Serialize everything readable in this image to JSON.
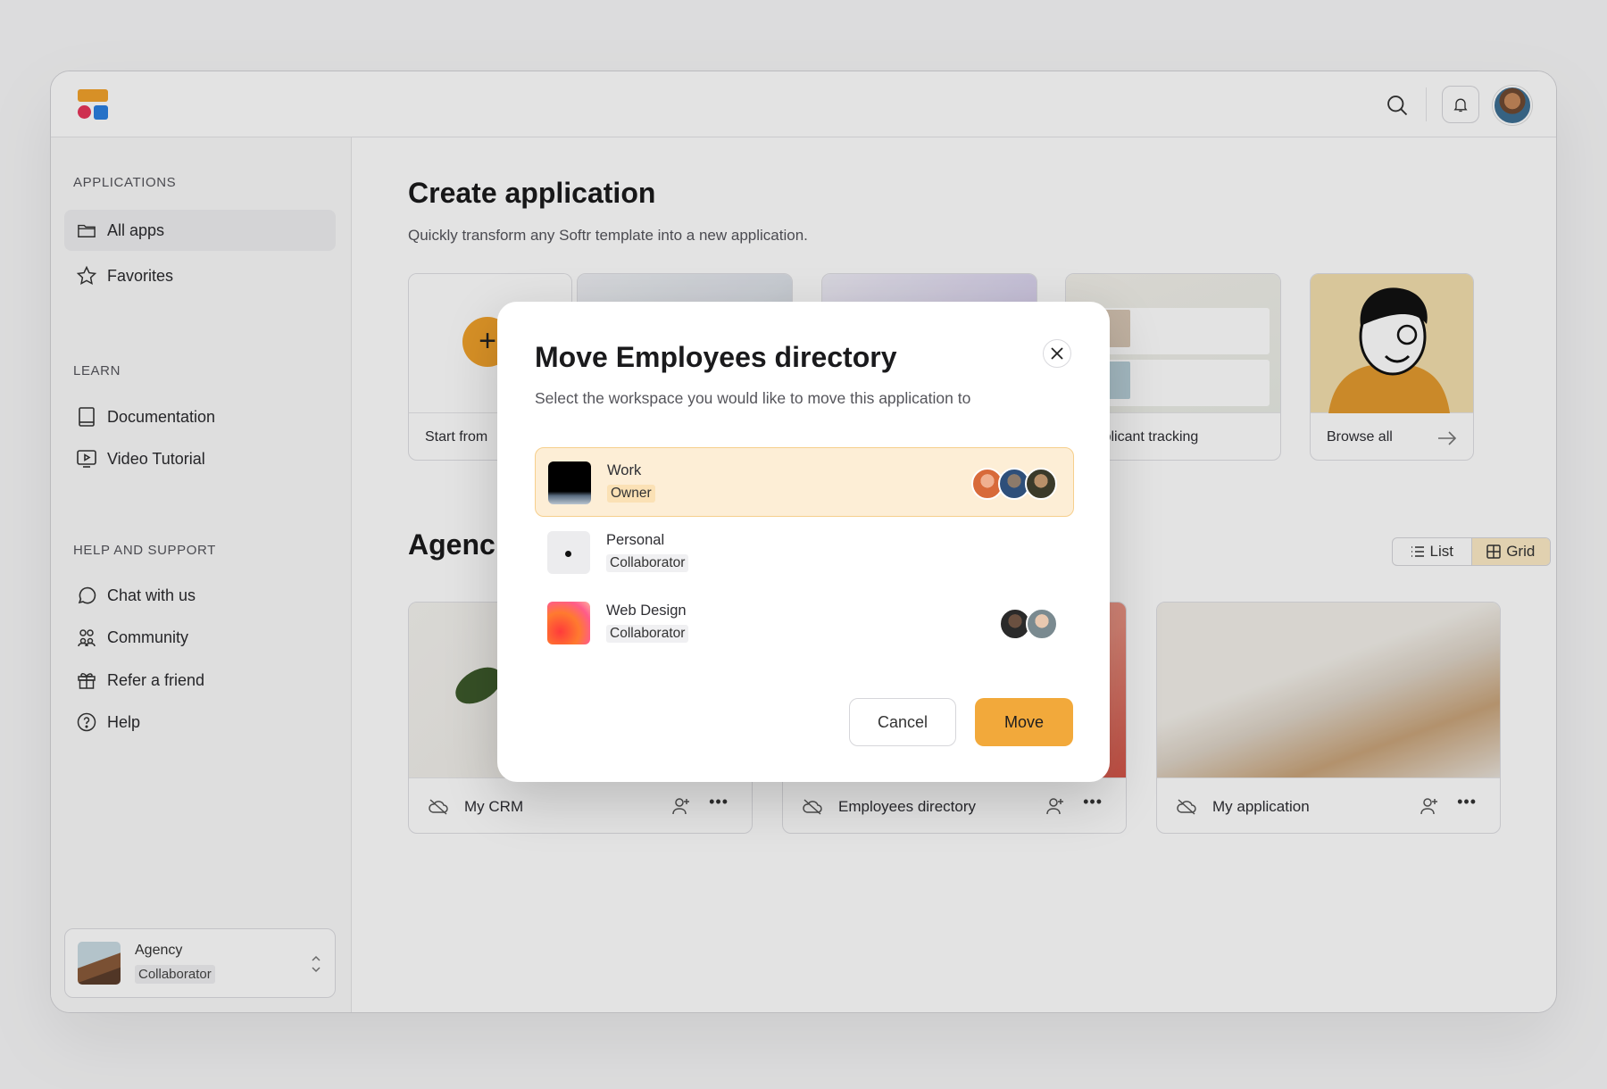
{
  "sidebar": {
    "sections": [
      {
        "heading": "APPLICATIONS",
        "items": [
          {
            "label": "All apps",
            "icon": "folder-icon",
            "active": true
          },
          {
            "label": "Favorites",
            "icon": "star-icon"
          }
        ]
      },
      {
        "heading": "LEARN",
        "items": [
          {
            "label": "Documentation",
            "icon": "book-icon"
          },
          {
            "label": "Video Tutorial",
            "icon": "video-icon"
          }
        ]
      },
      {
        "heading": "HELP AND SUPPORT",
        "items": [
          {
            "label": "Chat with us",
            "icon": "chat-icon"
          },
          {
            "label": "Community",
            "icon": "community-icon"
          },
          {
            "label": "Refer a friend",
            "icon": "gift-icon"
          },
          {
            "label": "Help",
            "icon": "help-icon"
          }
        ]
      }
    ],
    "workspace": {
      "name": "Agency",
      "role": "Collaborator"
    }
  },
  "main": {
    "title": "Create application",
    "subtitle": "Quickly transform any Softr template into a new application.",
    "templates": [
      {
        "label": "Start from"
      },
      {
        "label": ""
      },
      {
        "label": ""
      },
      {
        "label": "Applicant tracking"
      },
      {
        "label": "Browse all"
      }
    ],
    "section_title": "Agenc",
    "view_toggle": {
      "list": "List",
      "grid": "Grid",
      "selected": "Grid"
    },
    "apps": [
      {
        "title": "My CRM"
      },
      {
        "title": "Employees directory"
      },
      {
        "title": "My application"
      }
    ]
  },
  "modal": {
    "title": "Move Employees directory",
    "subtitle": "Select the workspace you would like to move this application to",
    "workspaces": [
      {
        "name": "Work",
        "role": "Owner",
        "selected": true
      },
      {
        "name": "Personal",
        "role": "Collaborator",
        "selected": false
      },
      {
        "name": "Web Design",
        "role": "Collaborator",
        "selected": false
      }
    ],
    "cancel_label": "Cancel",
    "move_label": "Move"
  },
  "colors": {
    "accent": "#f2a22b",
    "selected_bg": "#fdeed6",
    "brand_red": "#e8365a",
    "brand_blue": "#2a7fe0"
  }
}
